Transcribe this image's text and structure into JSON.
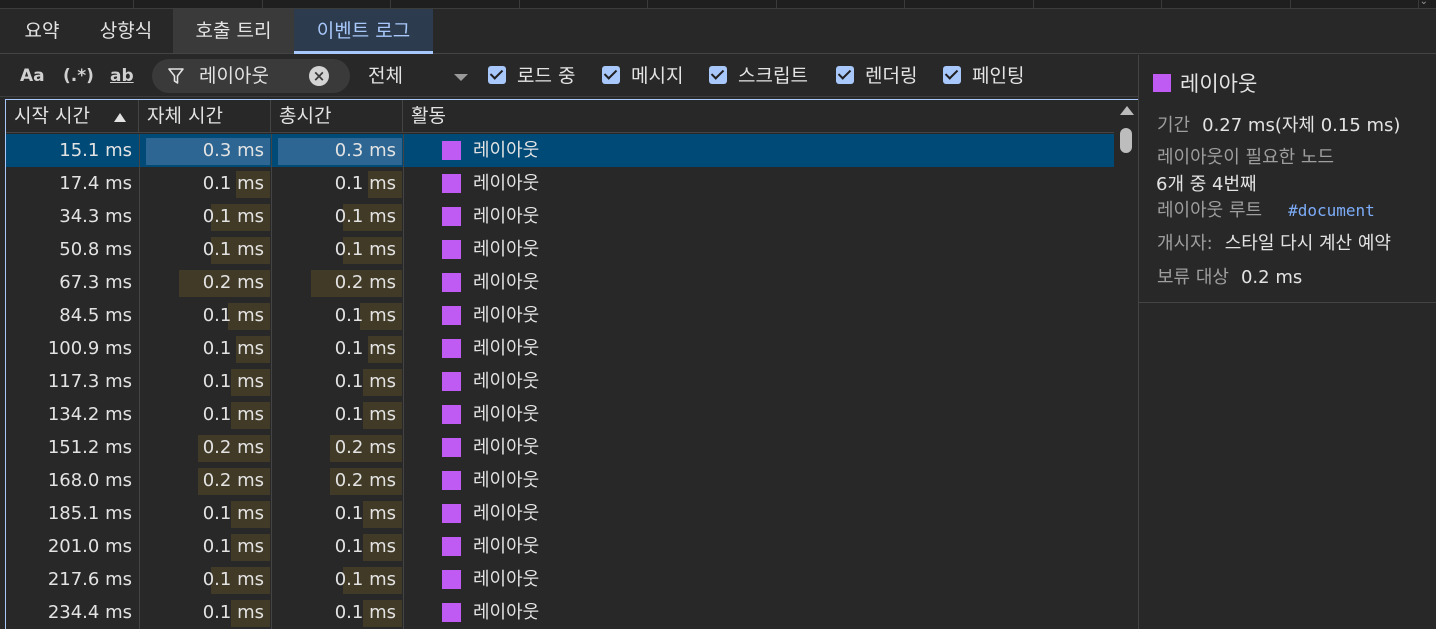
{
  "tabs": [
    {
      "label": "요약"
    },
    {
      "label": "상향식"
    },
    {
      "label": "호출 트리"
    },
    {
      "label": "이벤트 로그"
    }
  ],
  "toolbar": {
    "match_case_label": "Aa",
    "regex_label": "(.*)",
    "whole_word_label": "ab",
    "filter_value": "레이아웃",
    "duration_select": "전체",
    "checkboxes": [
      {
        "label": "로드 중",
        "checked": true
      },
      {
        "label": "메시지",
        "checked": true
      },
      {
        "label": "스크립트",
        "checked": true
      },
      {
        "label": "렌더링",
        "checked": true
      },
      {
        "label": "페인팅",
        "checked": true
      }
    ]
  },
  "table": {
    "headers": [
      "시작 시간",
      "자체 시간",
      "총시간",
      "활동"
    ],
    "rows": [
      {
        "start": "15.1 ms",
        "self": "0.3 ms",
        "total": "0.3 ms",
        "activity": "레이아웃",
        "fill": 0.95
      },
      {
        "start": "17.4 ms",
        "self": "0.1 ms",
        "total": "0.1 ms",
        "activity": "레이아웃",
        "fill": 0.26
      },
      {
        "start": "34.3 ms",
        "self": "0.1 ms",
        "total": "0.1 ms",
        "activity": "레이아웃",
        "fill": 0.45
      },
      {
        "start": "50.8 ms",
        "self": "0.1 ms",
        "total": "0.1 ms",
        "activity": "레이아웃",
        "fill": 0.45
      },
      {
        "start": "67.3 ms",
        "self": "0.2 ms",
        "total": "0.2 ms",
        "activity": "레이아웃",
        "fill": 0.7
      },
      {
        "start": "84.5 ms",
        "self": "0.1 ms",
        "total": "0.1 ms",
        "activity": "레이아웃",
        "fill": 0.32
      },
      {
        "start": "100.9 ms",
        "self": "0.1 ms",
        "total": "0.1 ms",
        "activity": "레이아웃",
        "fill": 0.26
      },
      {
        "start": "117.3 ms",
        "self": "0.1 ms",
        "total": "0.1 ms",
        "activity": "레이아웃",
        "fill": 0.3
      },
      {
        "start": "134.2 ms",
        "self": "0.1 ms",
        "total": "0.1 ms",
        "activity": "레이아웃",
        "fill": 0.3
      },
      {
        "start": "151.2 ms",
        "self": "0.2 ms",
        "total": "0.2 ms",
        "activity": "레이아웃",
        "fill": 0.55
      },
      {
        "start": "168.0 ms",
        "self": "0.2 ms",
        "total": "0.2 ms",
        "activity": "레이아웃",
        "fill": 0.55
      },
      {
        "start": "185.1 ms",
        "self": "0.1 ms",
        "total": "0.1 ms",
        "activity": "레이아웃",
        "fill": 0.3
      },
      {
        "start": "201.0 ms",
        "self": "0.1 ms",
        "total": "0.1 ms",
        "activity": "레이아웃",
        "fill": 0.3
      },
      {
        "start": "217.6 ms",
        "self": "0.1 ms",
        "total": "0.1 ms",
        "activity": "레이아웃",
        "fill": 0.45
      },
      {
        "start": "234.4 ms",
        "self": "0.1 ms",
        "total": "0.1 ms",
        "activity": "레이아웃",
        "fill": 0.3
      }
    ]
  },
  "details": {
    "title": "레이아웃",
    "duration_label": "기간",
    "duration_value": "0.27 ms(자체 0.15 ms)",
    "nodes_label": "레이아웃이 필요한 노드",
    "nodes_value": "6개 중 4번째",
    "root_label": "레이아웃 루트",
    "root_value": "#document",
    "initiator_label": "개시자:",
    "initiator_value": "스타일 다시 계산 예약",
    "pending_label": "보류 대상",
    "pending_value": "0.2 ms"
  },
  "colors": {
    "accent": "#a8c7fa",
    "selected_row": "#004a77",
    "layout_swatch": "#bf5af2",
    "time_bar": "#413a26"
  }
}
